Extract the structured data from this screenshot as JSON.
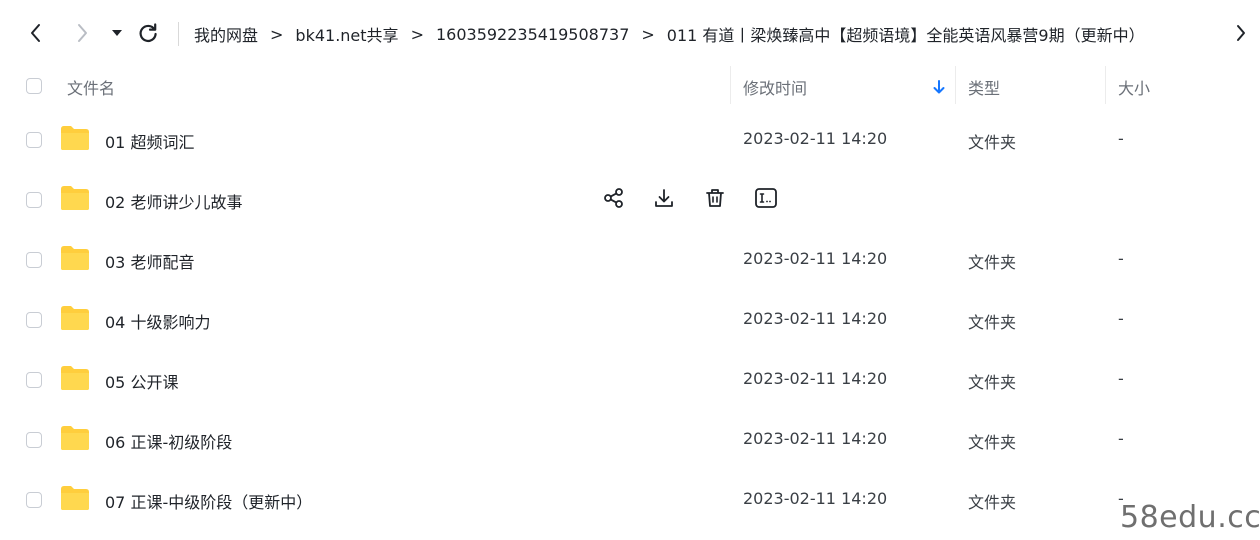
{
  "breadcrumb": {
    "items": [
      "我的网盘",
      "bk41.net共享",
      "1603592235419508737",
      "011 有道丨梁焕臻高中【超频语境】全能英语风暴营9期（更新中）"
    ],
    "separator": ">"
  },
  "nav_icons": {
    "back": "chevron-left-icon",
    "forward": "chevron-right-icon",
    "history": "caret-down-icon",
    "refresh": "refresh-icon",
    "more": "chevron-right-icon"
  },
  "table": {
    "headers": {
      "name": "文件名",
      "modified": "修改时间",
      "type": "类型",
      "size": "大小"
    },
    "sort": {
      "column": "modified",
      "direction": "descending",
      "icon": "arrow-down-icon",
      "color": "#1677ff"
    },
    "rows": [
      {
        "name": "01 超频词汇",
        "modified": "2023-02-11 14:20",
        "type": "文件夹",
        "size": "-"
      },
      {
        "name": "02 老师讲少儿故事",
        "modified": "",
        "type": "",
        "size": "",
        "hovered": true
      },
      {
        "name": "03 老师配音",
        "modified": "2023-02-11 14:20",
        "type": "文件夹",
        "size": "-"
      },
      {
        "name": "04 十级影响力",
        "modified": "2023-02-11 14:20",
        "type": "文件夹",
        "size": "-"
      },
      {
        "name": "05 公开课",
        "modified": "2023-02-11 14:20",
        "type": "文件夹",
        "size": "-"
      },
      {
        "name": "06 正课-初级阶段",
        "modified": "2023-02-11 14:20",
        "type": "文件夹",
        "size": "-"
      },
      {
        "name": "07 正课-中级阶段（更新中）",
        "modified": "2023-02-11 14:20",
        "type": "文件夹",
        "size": "-"
      }
    ]
  },
  "hover_actions": [
    "share-icon",
    "download-icon",
    "delete-icon",
    "rename-icon"
  ],
  "colors": {
    "folder": "#ffce3d",
    "accent": "#1677ff",
    "text": "#1f2329",
    "muted": "#6b7078"
  },
  "watermark": "58edu.cc"
}
